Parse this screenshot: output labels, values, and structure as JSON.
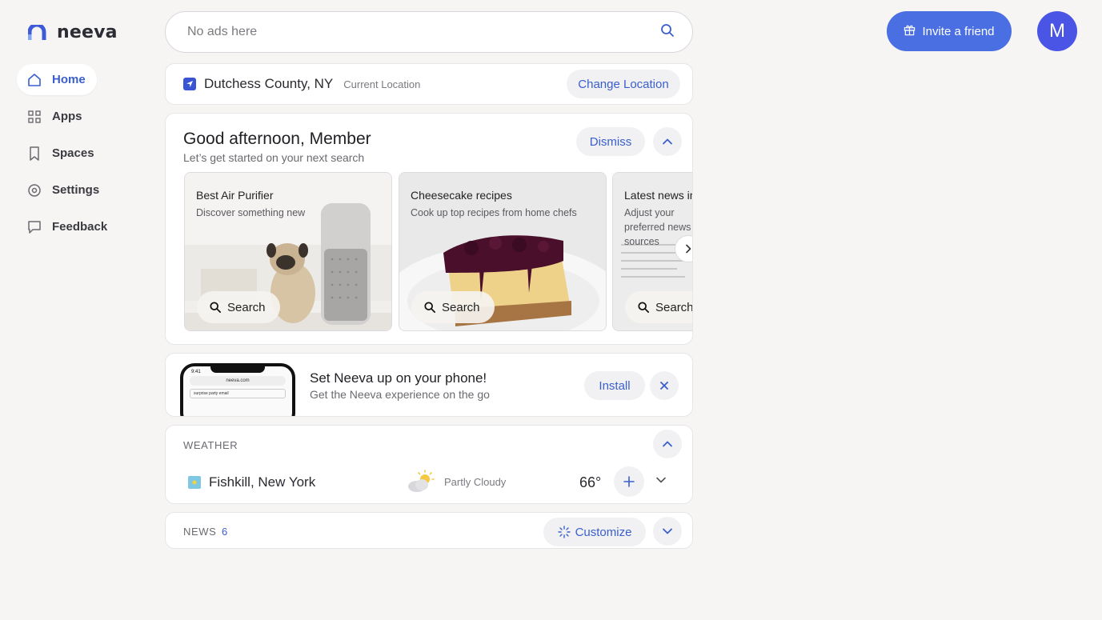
{
  "brand": {
    "name": "neeva"
  },
  "sidebar": {
    "items": [
      {
        "label": "Home",
        "icon": "home-icon",
        "active": true
      },
      {
        "label": "Apps",
        "icon": "apps-grid-icon"
      },
      {
        "label": "Spaces",
        "icon": "bookmark-icon"
      },
      {
        "label": "Settings",
        "icon": "gear-icon"
      },
      {
        "label": "Feedback",
        "icon": "chat-bubble-icon"
      }
    ]
  },
  "search": {
    "placeholder": "No ads here"
  },
  "header": {
    "invite_label": "Invite a friend",
    "avatar_letter": "M"
  },
  "location": {
    "name": "Dutchess County, NY",
    "sub": "Current Location",
    "change_label": "Change Location"
  },
  "greeting": {
    "title": "Good afternoon, Member",
    "subtitle": "Let’s get started on your next search",
    "dismiss_label": "Dismiss",
    "tiles": [
      {
        "title": "Best Air Purifier",
        "subtitle": "Discover something new",
        "button": "Search"
      },
      {
        "title": "Cheesecake recipes",
        "subtitle": "Cook up top recipes from home chefs",
        "button": "Search"
      },
      {
        "title": "Latest news in",
        "subtitle": "Adjust your preferred news sources",
        "button": "Search"
      }
    ]
  },
  "install": {
    "title": "Set Neeva up on your phone!",
    "subtitle": "Get the Neeva experience on the go",
    "button": "Install",
    "phone_time": "9:41",
    "phone_url": "neeva.com",
    "phone_query": "surprise party email"
  },
  "weather": {
    "label": "WEATHER",
    "city": "Fishkill, New York",
    "condition": "Partly Cloudy",
    "temp": "66°"
  },
  "news": {
    "label": "NEWS",
    "count": "6",
    "customize_label": "Customize"
  },
  "colors": {
    "accent": "#3a5fcd",
    "invite": "#4a6fe3",
    "avatar": "#4a55e6"
  }
}
